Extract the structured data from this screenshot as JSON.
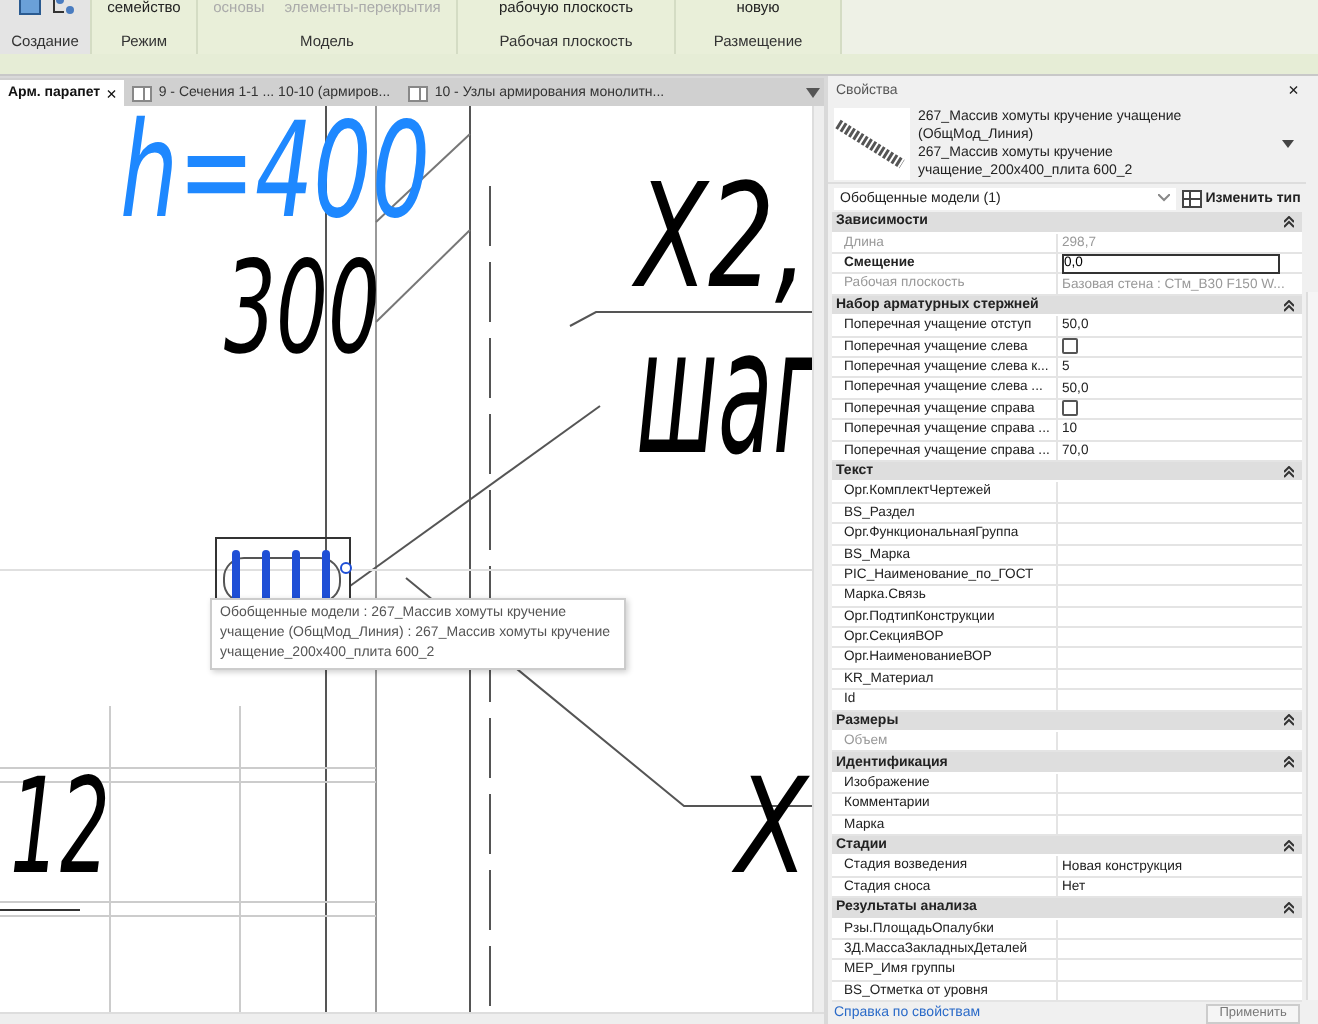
{
  "ribbon": {
    "groups": [
      {
        "label": "Создание"
      },
      {
        "label": "Режим",
        "buttons": [
          {
            "label": "семейство",
            "disabled": false
          }
        ]
      },
      {
        "label": "Модель",
        "buttons": [
          {
            "label": "основы",
            "disabled": true
          },
          {
            "label": "элементы-перекрытия",
            "disabled": true
          }
        ]
      },
      {
        "label": "Рабочая плоскость",
        "buttons": [
          {
            "label": "рабочую плоскость",
            "disabled": false
          }
        ]
      },
      {
        "label": "Размещение",
        "buttons": [
          {
            "label": "новую",
            "disabled": false
          }
        ]
      }
    ]
  },
  "view_tabs": [
    {
      "label": "Арм. парапет",
      "selected": true,
      "close": "×"
    },
    {
      "label": "9 - Сечения 1-1 ... 10-10 (армиров...",
      "selected": false
    },
    {
      "label": "10 - Узлы армирования монолитн...",
      "selected": false
    }
  ],
  "canvas": {
    "annotations": [
      {
        "text": "h=400",
        "color": "#1e88ff"
      },
      {
        "text": "300",
        "color": "#000000"
      },
      {
        "text": "X2,",
        "color": "#000000"
      },
      {
        "text": "шаг",
        "color": "#000000"
      },
      {
        "text": "12",
        "color": "#000000"
      },
      {
        "text": "X",
        "color": "#000000"
      }
    ],
    "tooltip": "Обобщенные модели : 267_Массив хомуты кручение учащение (ОбщМод_Линия) : 267_Массив хомуты кручение учащение_200х400_плита 600_2"
  },
  "properties": {
    "title": "Свойства",
    "close": "×",
    "type_family": "267_Массив хомуты кручение учащение (ОбщМод_Линия)",
    "type_name": "267_Массив хомуты кручение учащение_200х400_плита 600_2",
    "selector": "Обобщенные модели (1)",
    "edit_type_button": "Изменить тип",
    "groups": [
      {
        "title": "Зависимости",
        "expanded": true,
        "rows": [
          {
            "label": "Длина",
            "value": "298,7",
            "kind": "text",
            "disabled": true
          },
          {
            "label": "Смещение",
            "value": "0,0",
            "kind": "input",
            "disabled": false
          },
          {
            "label": "Рабочая плоскость",
            "value": "Базовая стена : СТм_В30 F150 W...",
            "kind": "text",
            "disabled": true
          }
        ]
      },
      {
        "title": "Набор арматурных стержней",
        "expanded": true,
        "rows": [
          {
            "label": "Поперечная учащение отступ",
            "value": "50,0",
            "kind": "text",
            "disabled": false
          },
          {
            "label": "Поперечная учащение слева",
            "checked": false,
            "kind": "checkbox",
            "disabled": false
          },
          {
            "label": "Поперечная учащение слева к...",
            "value": "5",
            "kind": "text",
            "disabled": false
          },
          {
            "label": "Поперечная учащение слева ...",
            "value": "50,0",
            "kind": "text",
            "disabled": false
          },
          {
            "label": "Поперечная учащение справа",
            "checked": false,
            "kind": "checkbox",
            "disabled": false
          },
          {
            "label": "Поперечная учащение справа ...",
            "value": "10",
            "kind": "text",
            "disabled": false
          },
          {
            "label": "Поперечная учащение справа ...",
            "value": "70,0",
            "kind": "text",
            "disabled": false
          }
        ]
      },
      {
        "title": "Текст",
        "expanded": true,
        "rows": [
          {
            "label": "Орг.КомплектЧертежей",
            "kind": "text",
            "disabled": false
          },
          {
            "label": "BS_Раздел",
            "kind": "text",
            "disabled": false
          },
          {
            "label": "Орг.ФункциональнаяГруппа",
            "kind": "text",
            "disabled": false
          },
          {
            "label": "BS_Марка",
            "kind": "text",
            "disabled": false
          },
          {
            "label": "PIC_Наименование_по_ГОСТ",
            "kind": "text",
            "disabled": false
          },
          {
            "label": "Марка.Связь",
            "kind": "text",
            "disabled": false
          },
          {
            "label": "Орг.ПодтипКонструкции",
            "kind": "text",
            "disabled": false
          },
          {
            "label": "Орг.СекцияВОР",
            "kind": "text",
            "disabled": false
          },
          {
            "label": "Орг.НаименованиеВОР",
            "kind": "text",
            "disabled": false
          },
          {
            "label": "KR_Материал",
            "kind": "text",
            "disabled": false
          },
          {
            "label": "Id",
            "kind": "text",
            "disabled": false
          }
        ]
      },
      {
        "title": "Размеры",
        "expanded": true,
        "rows": [
          {
            "label": "Объем",
            "kind": "text",
            "disabled": true
          }
        ]
      },
      {
        "title": "Идентификация",
        "expanded": true,
        "rows": [
          {
            "label": "Изображение",
            "kind": "text",
            "disabled": false
          },
          {
            "label": "Комментарии",
            "kind": "text",
            "disabled": false
          },
          {
            "label": "Марка",
            "kind": "text",
            "disabled": false
          }
        ]
      },
      {
        "title": "Стадии",
        "expanded": true,
        "rows": [
          {
            "label": "Стадия возведения",
            "value": "Новая конструкция",
            "kind": "text",
            "disabled": false
          },
          {
            "label": "Стадия сноса",
            "value": "Нет",
            "kind": "text",
            "disabled": false
          }
        ]
      },
      {
        "title": "Результаты анализа",
        "expanded": true,
        "rows": [
          {
            "label": "Рзы.ПлощадьОпалубки",
            "kind": "text",
            "disabled": false
          },
          {
            "label": "3Д.МассаЗакладныхДеталей",
            "kind": "text",
            "disabled": false
          },
          {
            "label": "MEP_Имя группы",
            "kind": "text",
            "disabled": false
          },
          {
            "label": "BS_Отметка от уровня",
            "kind": "text",
            "disabled": false
          }
        ]
      }
    ],
    "help_link": "Справка по свойствам",
    "apply_button": "Применить"
  }
}
